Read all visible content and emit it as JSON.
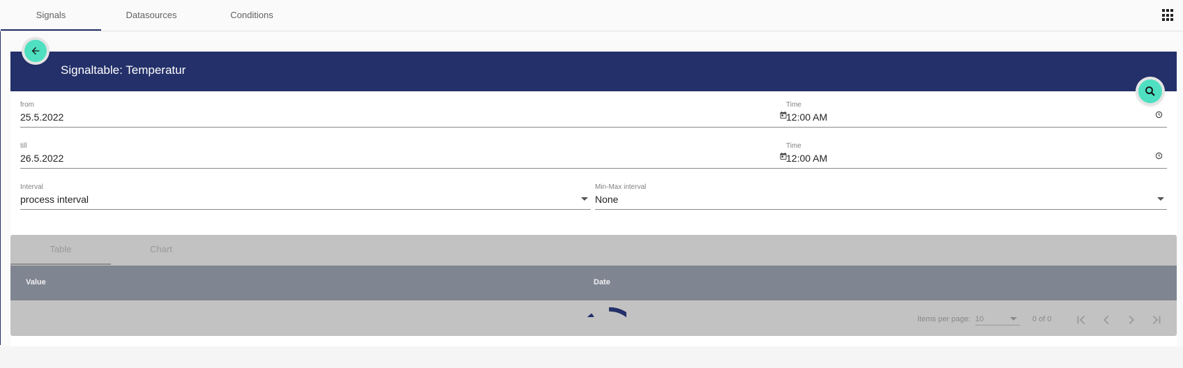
{
  "nav": {
    "tabs": [
      {
        "label": "Signals",
        "active": true
      },
      {
        "label": "Datasources",
        "active": false
      },
      {
        "label": "Conditions",
        "active": false
      }
    ],
    "apps_icon": "apps-grid-icon"
  },
  "header": {
    "title": "Signaltable: Temperatur",
    "back_icon": "arrow-left-icon",
    "search_icon": "search-icon",
    "accent_color": "#233069",
    "fab_color": "#4ee0c1"
  },
  "form": {
    "from": {
      "label": "from",
      "value": "25.5.2022",
      "icon": "calendar-icon"
    },
    "from_time": {
      "label": "Time",
      "value": "12:00 AM",
      "icon": "clock-icon"
    },
    "till": {
      "label": "till",
      "value": "26.5.2022",
      "icon": "calendar-icon"
    },
    "till_time": {
      "label": "Time",
      "value": "12:00 AM",
      "icon": "clock-icon"
    },
    "interval": {
      "label": "Interval",
      "value": "process interval"
    },
    "minmax": {
      "label": "Min-Max interval",
      "value": "None"
    }
  },
  "results": {
    "tabs": [
      {
        "label": "Table",
        "active": true
      },
      {
        "label": "Chart",
        "active": false
      }
    ],
    "columns": [
      "Value",
      "Date"
    ],
    "rows": [],
    "paginator": {
      "items_per_page_label": "Items per page:",
      "items_per_page": "10",
      "range": "0 of 0"
    },
    "loading": true
  }
}
